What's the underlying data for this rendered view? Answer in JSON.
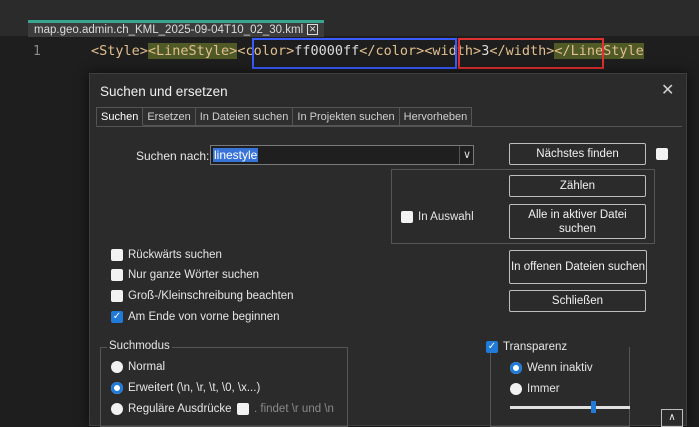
{
  "editor": {
    "file_tab": "map.geo.admin.ch_KML_2025-09-04T10_02_30.kml",
    "tab_close": "✕",
    "line_number": "1",
    "code": {
      "t1": "<Style>",
      "t2": "<LineStyle>",
      "t3": "<color>",
      "v3": "ff0000ff",
      "t4": "</color>",
      "t5": "<width>",
      "v5": "3",
      "t6": "</width>",
      "t7": "</LineStyle"
    }
  },
  "dialog": {
    "title": "Suchen und ersetzen",
    "close": "✕",
    "tabs": [
      "Suchen",
      "Ersetzen",
      "In Dateien suchen",
      "In Projekten suchen",
      "Hervorheben"
    ],
    "find_label": "Suchen nach:",
    "find_value": "linestyle",
    "dropdown_glyph": "∨",
    "buttons": {
      "find_next": "Nächstes finden",
      "count": "Zählen",
      "find_all_active": "Alle in aktiver Datei suchen",
      "find_all_open": "In offenen Dateien suchen",
      "close": "Schließen"
    },
    "in_selection": "In Auswahl",
    "options": {
      "backward": "Rückwärts suchen",
      "whole_word": "Nur ganze Wörter suchen",
      "match_case": "Groß-/Kleinschreibung beachten",
      "wrap_around": "Am Ende von vorne beginnen"
    },
    "search_mode": {
      "legend": "Suchmodus",
      "normal": "Normal",
      "extended": "Erweitert (\\n, \\r, \\t, \\0, \\x...)",
      "regex": "Reguläre Ausdrücke",
      "dot_newline": ". findet \\r und \\n"
    },
    "transparency": {
      "label": "Transparenz",
      "on_inactive": "Wenn inaktiv",
      "always": "Immer",
      "slider_level": 0.7
    },
    "collapse_glyph": "∧"
  },
  "colors": {
    "accent": "#1f7ad8",
    "blue_box": "#3a5bff",
    "red_box": "#e03030",
    "tag": "#e2c08d",
    "highlight": "#4f5a26"
  }
}
